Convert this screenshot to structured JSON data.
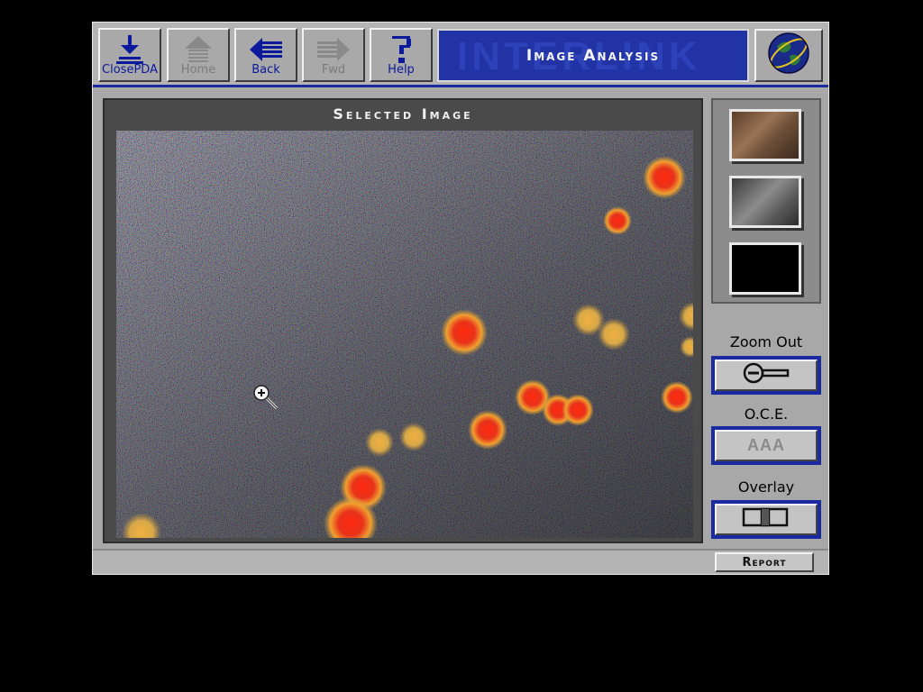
{
  "toolbar": {
    "buttons": [
      {
        "label": "ClosePDA",
        "icon": "close-pda-icon",
        "enabled": true
      },
      {
        "label": "Home",
        "icon": "home-icon",
        "enabled": false
      },
      {
        "label": "Back",
        "icon": "back-arrow-icon",
        "enabled": true
      },
      {
        "label": "Fwd",
        "icon": "forward-arrow-icon",
        "enabled": false
      },
      {
        "label": "Help",
        "icon": "help-icon",
        "enabled": true
      }
    ],
    "title": "Image Analysis",
    "globe_icon": "globe-icon"
  },
  "image_panel": {
    "title": "Selected Image",
    "cursor_icon": "magnifier-zoom-in-icon"
  },
  "sidebar": {
    "thumbnails": [
      {
        "name": "thumbnail-1"
      },
      {
        "name": "thumbnail-2"
      },
      {
        "name": "thumbnail-3"
      }
    ],
    "zoom_out_label": "Zoom Out",
    "oce_label": "O.C.E.",
    "oce_button_text": "AAA",
    "overlay_label": "Overlay"
  },
  "status_bar": {
    "report_label": "Report"
  },
  "colors": {
    "accent_blue": "#1a2aa0",
    "title_bar": "#2233a6",
    "panel_gray": "#a8a8a8",
    "hotspot_red": "#e02818",
    "hotspot_yellow": "#e8b040"
  }
}
